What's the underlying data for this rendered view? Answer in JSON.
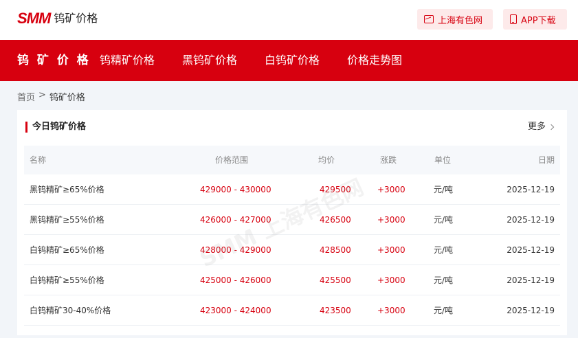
{
  "header": {
    "logo_mark": "SMM",
    "logo_text": "钨矿价格",
    "btn_web": "上海有色网",
    "btn_app": "APP下载"
  },
  "nav": {
    "items": [
      {
        "label": "钨 矿 价 格"
      },
      {
        "label": "钨精矿价格"
      },
      {
        "label": "黑钨矿价格"
      },
      {
        "label": "白钨矿价格"
      },
      {
        "label": "价格走势图"
      }
    ]
  },
  "breadcrumb": {
    "home": "首页",
    "sep": ">",
    "current": "钨矿价格"
  },
  "card": {
    "title": "今日钨矿价格",
    "more": "更多"
  },
  "table": {
    "headers": {
      "name": "名称",
      "range": "价格范围",
      "avg": "均价",
      "change": "涨跌",
      "unit": "单位",
      "date": "日期"
    },
    "rows": [
      {
        "name": "黑钨精矿≥65%价格",
        "range": "429000 - 430000",
        "avg": "429500",
        "change": "+3000",
        "unit": "元/吨",
        "date": "2025-12-19"
      },
      {
        "name": "黑钨精矿≥55%价格",
        "range": "426000 - 427000",
        "avg": "426500",
        "change": "+3000",
        "unit": "元/吨",
        "date": "2025-12-19"
      },
      {
        "name": "白钨精矿≥65%价格",
        "range": "428000 - 429000",
        "avg": "428500",
        "change": "+3000",
        "unit": "元/吨",
        "date": "2025-12-19"
      },
      {
        "name": "白钨精矿≥55%价格",
        "range": "425000 - 426000",
        "avg": "425500",
        "change": "+3000",
        "unit": "元/吨",
        "date": "2025-12-19"
      },
      {
        "name": "白钨精矿30-40%价格",
        "range": "423000 - 424000",
        "avg": "423500",
        "change": "+3000",
        "unit": "元/吨",
        "date": "2025-12-19"
      }
    ]
  },
  "watermark": "SMM 上海有色网",
  "colors": {
    "brand_red": "#d7000f",
    "page_bg": "#f2f5f9"
  }
}
